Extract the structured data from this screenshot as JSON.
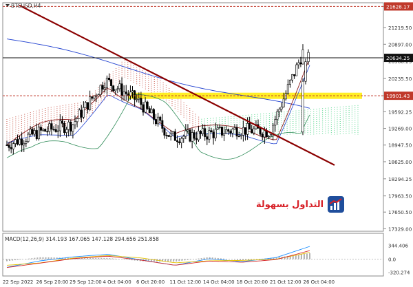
{
  "symbol_label": "BTCUSD,H4",
  "watermark_text": "التداول بسهولة",
  "main_price_axis": {
    "ticks": [
      21628.17,
      21219.5,
      20897.0,
      20566.25,
      20235.5,
      19901.43,
      19592.25,
      19269.0,
      18947.5,
      18625.0,
      18294.25,
      17963.5,
      17650.5,
      17329.0
    ],
    "tick_labels": [
      "21628.17",
      "21219.50",
      "20897.00",
      "20566.25",
      "20235.50",
      "19901.43",
      "19592.25",
      "19269.00",
      "18947.50",
      "18625.00",
      "18294.25",
      "17963.50",
      "17650.50",
      "17329.00"
    ]
  },
  "price_flags": [
    {
      "value": 21628.17,
      "label": "21628.17",
      "color": "#c0392b",
      "style": "dashed"
    },
    {
      "value": 20634.25,
      "label": "20634.25",
      "color": "#111111",
      "style": "solid"
    },
    {
      "value": 19901.43,
      "label": "19901.43",
      "color": "#c0392b",
      "style": "dashed"
    }
  ],
  "time_axis": [
    "22 Sep 2022",
    "26 Sep 20:00",
    "29 Sep 12:00",
    "4 Oct 04:00",
    "6 Oct 20:00",
    "11 Oct 12:00",
    "14 Oct 04:00",
    "18 Oct 20:00",
    "21 Oct 12:00",
    "26 Oct 04:00"
  ],
  "chart_data": [
    {
      "type": "line",
      "title": "BTCUSD,H4",
      "ylim": [
        17280,
        21700
      ],
      "x": [
        "22 Sep 2022",
        "26 Sep 20:00",
        "29 Sep 12:00",
        "4 Oct 04:00",
        "6 Oct 20:00",
        "11 Oct 12:00",
        "14 Oct 04:00",
        "18 Oct 20:00",
        "21 Oct 12:00",
        "26 Oct 04:00"
      ],
      "series": [
        {
          "values": [
            18950,
            19200,
            19350,
            20200,
            19800,
            19100,
            19150,
            19250,
            19210,
            20740
          ]
        }
      ],
      "trendline": {
        "from": [
          "22 Sep 2022",
          21650
        ],
        "to": [
          "26 Oct 04:00",
          18560
        ]
      },
      "resistance_zone": {
        "from": 19840,
        "to": 19960
      },
      "grid": false,
      "legend": "none",
      "price_flags": [
        21628.17,
        20634.25,
        19901.43
      ]
    },
    {
      "type": "line",
      "title": "MACD(12,26,9) 314.193 167.065 147.128 294.656 251.858",
      "ylim": [
        -380,
        400
      ],
      "ticks": [
        344.406,
        0.0,
        -320.274
      ],
      "tick_labels": [
        "344.406",
        "0.0",
        "-320.274"
      ],
      "x": [
        "22 Sep 2022",
        "26 Sep 20:00",
        "29 Sep 12:00",
        "4 Oct 04:00",
        "6 Oct 20:00",
        "11 Oct 12:00",
        "14 Oct 04:00",
        "18 Oct 20:00",
        "21 Oct 12:00",
        "26 Oct 04:00"
      ],
      "series": [
        {
          "values": [
            -200,
            -40,
            60,
            120,
            -20,
            -150,
            10,
            -60,
            40,
            314
          ]
        },
        {
          "values": [
            -150,
            -90,
            30,
            90,
            30,
            -90,
            -40,
            -30,
            0,
            167
          ]
        }
      ],
      "grid": false,
      "legend": "none"
    }
  ],
  "colors": {
    "trendline": "#8b0000",
    "zone": "#ffeb00",
    "kumo_bear": "#c0392b",
    "kumo_bull": "#2ecc71",
    "ma_blue": "#2040d0",
    "ma_red": "#8b1a1a",
    "chikou": "#2e8b57",
    "candle": "#000000",
    "macd_main": "#1e90ff",
    "macd_signal": "#e6c200",
    "macd_red": "#d62728",
    "hist": "#b0b0b0"
  },
  "icons": [
    "watermark-logo-icon"
  ]
}
